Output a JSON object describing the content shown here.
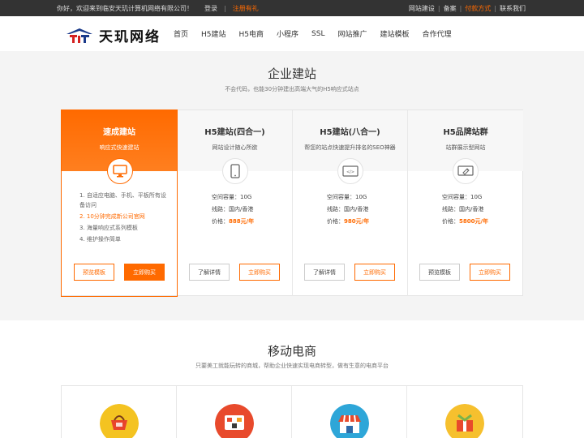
{
  "topbar": {
    "welcome": "你好，欢迎来到临安天玑计算机网络有限公司！",
    "login": "登录",
    "register": "注册有礼",
    "links": [
      "网站建设",
      "备案",
      "付款方式",
      "联系我们"
    ]
  },
  "header": {
    "logo_text": "天玑网络",
    "nav": [
      "首页",
      "H5建站",
      "H5电商",
      "小程序",
      "SSL",
      "网站推广",
      "建站模板",
      "合作代理"
    ]
  },
  "section1": {
    "title": "企业建站",
    "subtitle": "不会代码，也能30分钟建出高端大气的H5响应式站点",
    "cards": [
      {
        "title": "速成建站",
        "subtitle": "响应式快速建站",
        "icon": "monitor-icon",
        "features": [
          "1. 自适应电脑、手机、平板所有设备访问",
          "2. 10分钟完成新公司官网",
          "3. 海量响应式系列模板",
          "4. 维护操作简单"
        ],
        "buttons": [
          "预览模板",
          "立即购买"
        ]
      },
      {
        "title": "H5建站(四合一)",
        "subtitle": "网站设计随心所欲",
        "icon": "tablet-icon",
        "space_label": "空间容量：",
        "space": "10G",
        "line_label": "线路：",
        "line": "国内/香港",
        "price_label": "价格：",
        "price": "888元/年",
        "buttons": [
          "了解详情",
          "立即购买"
        ]
      },
      {
        "title": "H5建站(八合一)",
        "subtitle": "帮您的站点快速提升排名的SEO神器",
        "icon": "code-screen-icon",
        "space_label": "空间容量：",
        "space": "10G",
        "line_label": "线路：",
        "line": "国内/香港",
        "price_label": "价格：",
        "price": "980元/年",
        "buttons": [
          "了解详情",
          "立即购买"
        ]
      },
      {
        "title": "H5品牌站群",
        "subtitle": "站群展示型网站",
        "icon": "tag-screen-icon",
        "space_label": "空间容量：",
        "space": "10G",
        "line_label": "线路：",
        "line": "国内/香港",
        "price_label": "价格：",
        "price": "5800元/年",
        "buttons": [
          "预览模板",
          "立即购买"
        ]
      }
    ]
  },
  "section2": {
    "title": "移动电商",
    "subtitle": "只要美工就能玩转的商城，帮助企业快速实现电商转型，做有生意的电商平台",
    "icons": [
      "shopping-basket-icon",
      "storefront-icon",
      "shop-awning-icon",
      "gift-icon"
    ]
  },
  "colors": {
    "accent": "#ff6a00",
    "topbar": "#333333"
  }
}
